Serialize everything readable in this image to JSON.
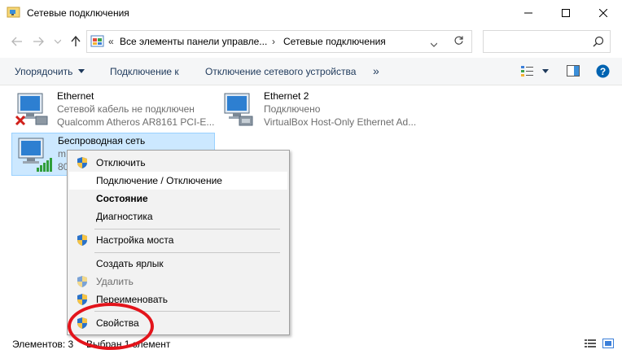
{
  "window": {
    "title": "Сетевые подключения"
  },
  "address": {
    "overflow": "«",
    "segment_1": "Все элементы панели управле...",
    "segment_2": "Сетевые подключения",
    "chevron": "›",
    "search_placeholder": ""
  },
  "toolbar": {
    "organize": "Упорядочить",
    "connect_to": "Подключение к",
    "disable_device": "Отключение сетевого устройства",
    "more": "»"
  },
  "adapters": [
    {
      "name": "Ethernet",
      "status": "Сетевой кабель не подключен",
      "device": "Qualcomm Atheros AR8161 PCI-E...",
      "icon": "ethernet-disconnected-icon"
    },
    {
      "name": "Ethernet 2",
      "status": "Подключено",
      "device": "VirtualBox Host-Only Ethernet Ad...",
      "icon": "ethernet-adapter-icon"
    },
    {
      "name": "Беспроводная сеть",
      "status": "m",
      "device": "80",
      "icon": "wireless-adapter-icon",
      "selected": true
    }
  ],
  "context_menu": {
    "items": [
      {
        "label": "Отключить",
        "shield": true
      },
      {
        "label": "Подключение / Отключение",
        "shield": false,
        "hover": true
      },
      {
        "label": "Состояние",
        "shield": false,
        "bold": true
      },
      {
        "label": "Диагностика",
        "shield": false
      },
      {
        "label": "Настройка моста",
        "shield": true
      },
      {
        "label": "Создать ярлык",
        "shield": false
      },
      {
        "label": "Удалить",
        "shield": true,
        "disabled": true
      },
      {
        "label": "Переименовать",
        "shield": true
      },
      {
        "label": "Свойства",
        "shield": true
      }
    ]
  },
  "status_bar": {
    "elements": "Элементов: 3",
    "selected": "Выбран 1 элемент"
  },
  "colors": {
    "selection_bg": "#cce8ff",
    "annotation_red": "#e3141b",
    "toolbar_text": "#1e395b",
    "help_blue": "#0063b1"
  }
}
